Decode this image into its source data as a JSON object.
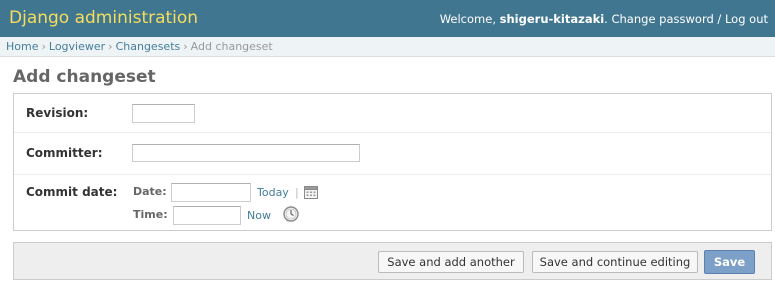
{
  "header": {
    "branding": "Django administration",
    "welcome": "Welcome, ",
    "username": "shigeru-kitazaki",
    "period": ".",
    "change_password": "Change password",
    "divider": " / ",
    "logout": "Log out"
  },
  "breadcrumbs": {
    "items": [
      "Home",
      "Logviewer",
      "Changesets"
    ],
    "current": "Add changeset",
    "separator": "›"
  },
  "page": {
    "title": "Add changeset"
  },
  "form": {
    "revision": {
      "label": "Revision:",
      "value": ""
    },
    "committer": {
      "label": "Committer:",
      "value": ""
    },
    "commit_date": {
      "label": "Commit date:",
      "date_label": "Date:",
      "date_value": "",
      "today": "Today",
      "time_label": "Time:",
      "time_value": "",
      "now": "Now",
      "pipe": "|"
    }
  },
  "submit": {
    "save_add_another": "Save and add another",
    "save_continue": "Save and continue editing",
    "save": "Save"
  },
  "icons": {
    "calendar": "calendar-icon",
    "clock": "clock-icon"
  },
  "colors": {
    "header_bg": "#417690",
    "branding": "#f5dd5d",
    "link": "#447e9b",
    "primary_button": "#7ca0c7"
  }
}
